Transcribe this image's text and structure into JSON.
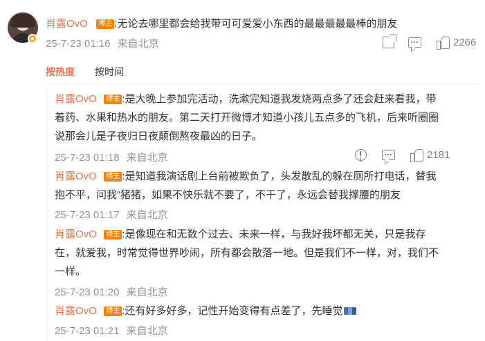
{
  "main_comment": {
    "username": "肖露OvO",
    "badge": "博主",
    "text": ":无论去哪里都会给我带可可爱爱小东西的最最最最最棒的朋友",
    "timestamp": "25-7-23 01:16",
    "location": "来自北京",
    "likes": "2266"
  },
  "sort_tabs": {
    "hot": "按热度",
    "time": "按时间"
  },
  "replies": [
    {
      "username": "肖露OvO",
      "badge": "博主",
      "lines": [
        ":是大晚上参加完活动，洗漱完知道我发烧两点多了还会赶来看我，带",
        "着药、水果和热水的朋友。第二天打开微博才知道小孩儿五点多的飞机，后来听圈圈",
        "说那会儿是子夜归日夜颠倒熬夜最凶的日子。"
      ],
      "timestamp": "25-7-23 01:18",
      "location": "来自北京",
      "likes": "2181"
    },
    {
      "username": "肖露OvO",
      "badge": "博主",
      "lines": [
        ":是知道我演话剧上台前被欺负了，头发散乱的躲在厕所打电话，替我",
        "抱不平，问我“猪猪，如果不快乐就不要了，不干了，永远会替我撑腰的朋友"
      ],
      "timestamp": "25-7-23 01:17",
      "location": "来自北京"
    },
    {
      "username": "肖露OvO",
      "badge": "博主",
      "lines": [
        ":是像现在和无数个过去、未来一样，与我好我坏都无关，只是我存",
        "在，就爱我，时常觉得世界吵闹，所有都会散落一地。但是我们不一样，对，我们不",
        "一样。"
      ],
      "timestamp": "25-7-23 01:20",
      "location": "来自北京"
    },
    {
      "username": "肖露OvO",
      "badge": "博主",
      "lines": [
        ":还有好多好多，记性开始变得有点差了，先睡觉"
      ],
      "timestamp": "25-7-23 01:21",
      "location": "来自北京"
    }
  ],
  "icons": {
    "share": "share-icon",
    "comment": "comment-icon",
    "like": "like-icon",
    "report": "report-icon",
    "sleep_emoji": "sleep-emoji-icon"
  },
  "colors": {
    "username": "#eb7350",
    "badge_bg": "#ff8200",
    "meta_text": "#939393",
    "active_tab": "#eb7350"
  }
}
